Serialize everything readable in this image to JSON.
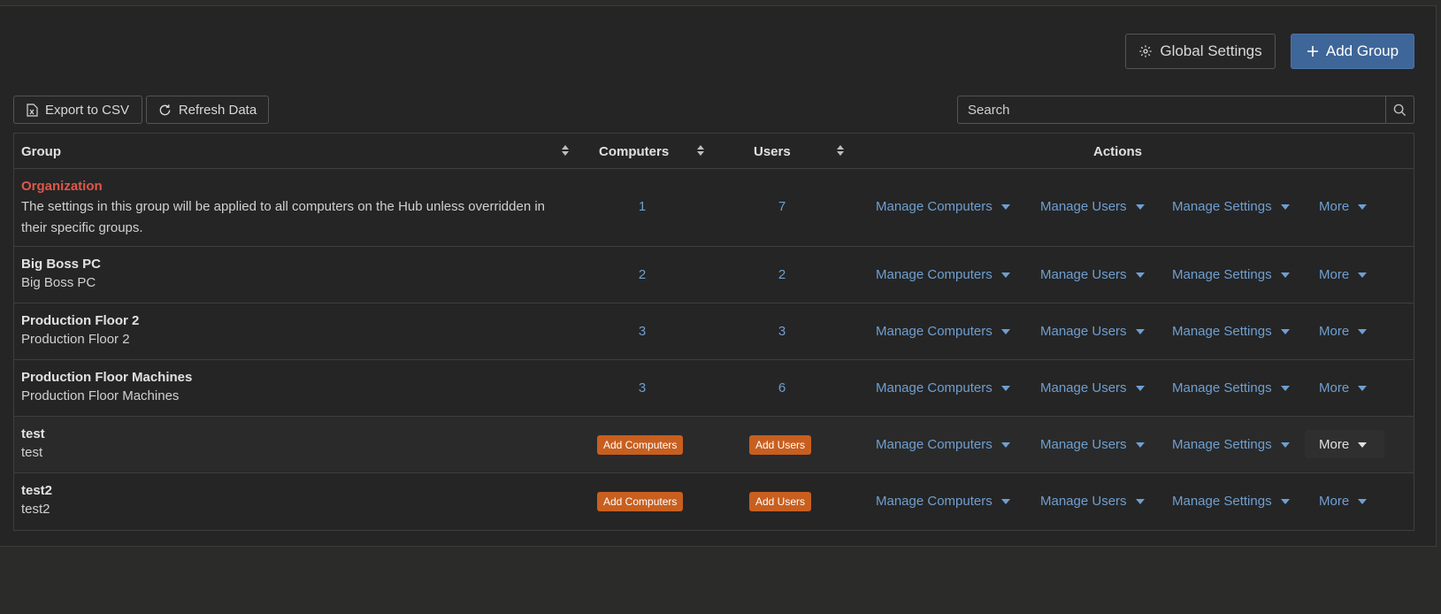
{
  "toolbar": {
    "global_settings_label": "Global Settings",
    "add_group_label": "Add Group",
    "export_label": "Export to CSV",
    "refresh_label": "Refresh Data",
    "search_placeholder": "Search"
  },
  "columns": {
    "group": "Group",
    "computers": "Computers",
    "users": "Users",
    "actions": "Actions"
  },
  "actions": {
    "manage_computers": "Manage Computers",
    "manage_users": "Manage Users",
    "manage_settings": "Manage Settings",
    "more": "More"
  },
  "badges": {
    "add_computers": "Add Computers",
    "add_users": "Add Users"
  },
  "rows": [
    {
      "name": "Organization",
      "description": "The settings in this group will be applied to all computers on the Hub unless overridden in their specific groups.",
      "computers": "1",
      "users": "7"
    },
    {
      "name": "Big Boss PC",
      "description": "Big Boss PC",
      "computers": "2",
      "users": "2"
    },
    {
      "name": "Production Floor 2",
      "description": "Production Floor 2",
      "computers": "3",
      "users": "3"
    },
    {
      "name": "Production Floor Machines",
      "description": "Production Floor Machines",
      "computers": "3",
      "users": "6"
    },
    {
      "name": "test",
      "description": "test",
      "computers": "",
      "users": ""
    },
    {
      "name": "test2",
      "description": "test2",
      "computers": "",
      "users": ""
    }
  ],
  "colors": {
    "accent": "#3e6699",
    "link": "#6f9fd0",
    "org_name": "#e0574a",
    "badge": "#c85f1f"
  }
}
